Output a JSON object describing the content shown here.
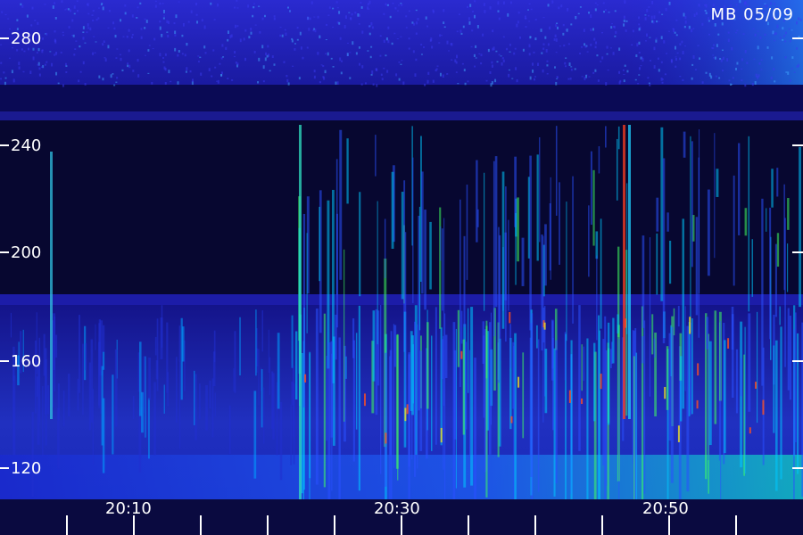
{
  "corner_tag": "MB 05/09",
  "y_axis": {
    "ticks": [
      {
        "label": "280",
        "value": 280
      },
      {
        "label": "240",
        "value": 240
      },
      {
        "label": "200",
        "value": 200
      },
      {
        "label": "160",
        "value": 160
      },
      {
        "label": "120",
        "value": 120
      }
    ],
    "range": [
      110,
      290
    ]
  },
  "x_axis": {
    "ticks": [
      {
        "label": "20:10"
      },
      {
        "label": "20:30"
      },
      {
        "label": "20:50"
      }
    ]
  },
  "colors": {
    "background": "#000000",
    "low": "#10107a",
    "mid": "#2a3cf0",
    "high": "#00e0ff",
    "peak": "#40ff60",
    "hot": "#ff4020",
    "text": "#ffffff"
  }
}
